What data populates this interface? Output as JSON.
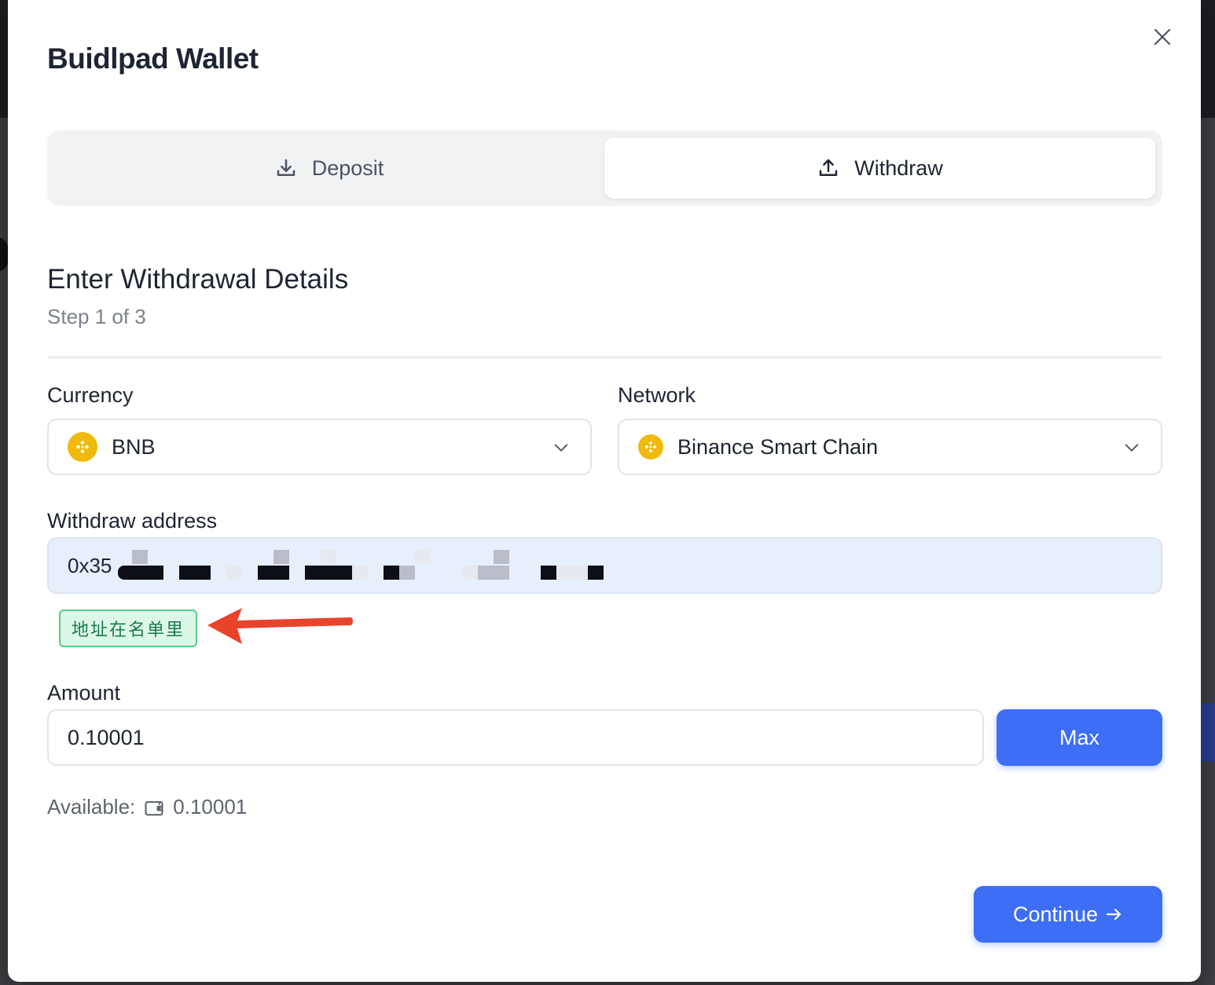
{
  "modal": {
    "title": "Buidlpad Wallet",
    "close_icon": "close-icon"
  },
  "tabs": [
    {
      "label": "Deposit",
      "icon": "download-icon",
      "active": false
    },
    {
      "label": "Withdraw",
      "icon": "upload-icon",
      "active": true
    }
  ],
  "section": {
    "title": "Enter Withdrawal Details",
    "step": "Step 1 of 3"
  },
  "currency": {
    "label": "Currency",
    "value": "BNB",
    "icon": "bnb-coin-icon"
  },
  "network": {
    "label": "Network",
    "value": "Binance Smart Chain",
    "icon": "bnb-coin-icon"
  },
  "address": {
    "label": "Withdraw address",
    "value_visible": "0x35",
    "redacted": true,
    "badge": "地址在名单里"
  },
  "amount": {
    "label": "Amount",
    "value": "0.10001",
    "max_label": "Max"
  },
  "available": {
    "label": "Available:",
    "icon": "wallet-icon",
    "value": "0.10001"
  },
  "continue": {
    "label": "Continue",
    "icon": "arrow-right-icon"
  },
  "colors": {
    "accent": "#3d6ef5",
    "badge_green": "#57c98e",
    "annotation_red": "#e8432b",
    "coin_gold": "#f0b90b"
  }
}
